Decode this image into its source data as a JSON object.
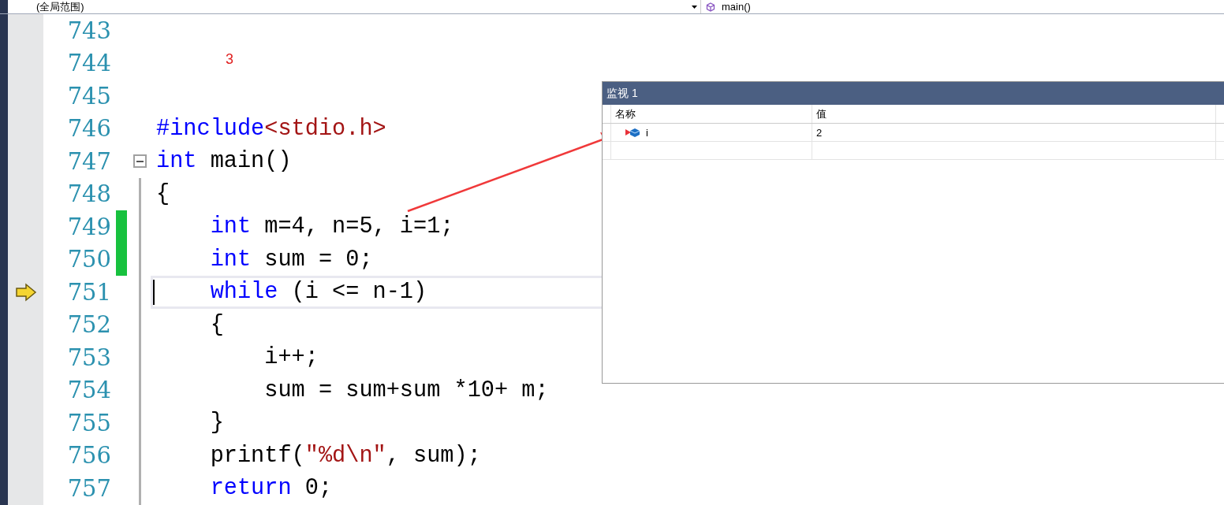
{
  "toolbar": {
    "scope": "(全局范围)",
    "function": "main()"
  },
  "lines": [
    {
      "number": "743",
      "changed": false,
      "current": false
    },
    {
      "number": "744",
      "changed": false,
      "current": false,
      "tokens": [
        {
          "kind": "annotation",
          "text": "3"
        }
      ]
    },
    {
      "number": "745",
      "changed": false,
      "current": false
    },
    {
      "number": "746",
      "changed": false,
      "current": false,
      "tokens": [
        {
          "kind": "keyword",
          "text": "#include"
        },
        {
          "kind": "string",
          "text": "<stdio.h>"
        }
      ]
    },
    {
      "number": "747",
      "changed": false,
      "current": false,
      "fold": {
        "expanded": true
      },
      "tokens": [
        {
          "kind": "keyword",
          "text": "int"
        },
        {
          "kind": "plain",
          "text": " main()"
        }
      ]
    },
    {
      "number": "748",
      "changed": false,
      "current": false,
      "tokens": [
        {
          "kind": "plain",
          "text": "{"
        }
      ]
    },
    {
      "number": "749",
      "changed": true,
      "current": false,
      "tokens": [
        {
          "kind": "keyword",
          "text": "    int"
        },
        {
          "kind": "plain",
          "text": " m=4, n=5, i=1;"
        }
      ]
    },
    {
      "number": "750",
      "changed": true,
      "current": false,
      "tokens": [
        {
          "kind": "keyword",
          "text": "    int"
        },
        {
          "kind": "plain",
          "text": " sum = 0;"
        }
      ]
    },
    {
      "number": "751",
      "changed": false,
      "current": true,
      "tokens": [
        {
          "kind": "keyword",
          "text": "    while"
        },
        {
          "kind": "plain",
          "text": " (i <= n-1)"
        }
      ]
    },
    {
      "number": "752",
      "changed": false,
      "current": false,
      "tokens": [
        {
          "kind": "plain",
          "text": "    {"
        }
      ]
    },
    {
      "number": "753",
      "changed": false,
      "current": false,
      "tokens": [
        {
          "kind": "plain",
          "text": "        i++;"
        }
      ]
    },
    {
      "number": "754",
      "changed": false,
      "current": false,
      "tokens": [
        {
          "kind": "plain",
          "text": "        sum = sum+sum *10+ m;"
        }
      ]
    },
    {
      "number": "755",
      "changed": false,
      "current": false,
      "tokens": [
        {
          "kind": "plain",
          "text": "    }"
        }
      ]
    },
    {
      "number": "756",
      "changed": false,
      "current": false,
      "tokens": [
        {
          "kind": "plain",
          "text": "    printf("
        },
        {
          "kind": "string",
          "text": "\"%d\\n\""
        },
        {
          "kind": "plain",
          "text": ", sum);"
        }
      ]
    },
    {
      "number": "757",
      "changed": false,
      "current": false,
      "tokens": [
        {
          "kind": "keyword",
          "text": "    return"
        },
        {
          "kind": "plain",
          "text": " 0;"
        }
      ]
    }
  ],
  "watch": {
    "title": "监视 1",
    "columns": [
      "名称",
      "值"
    ],
    "rows": [
      {
        "name": "i",
        "value": "2"
      }
    ]
  }
}
